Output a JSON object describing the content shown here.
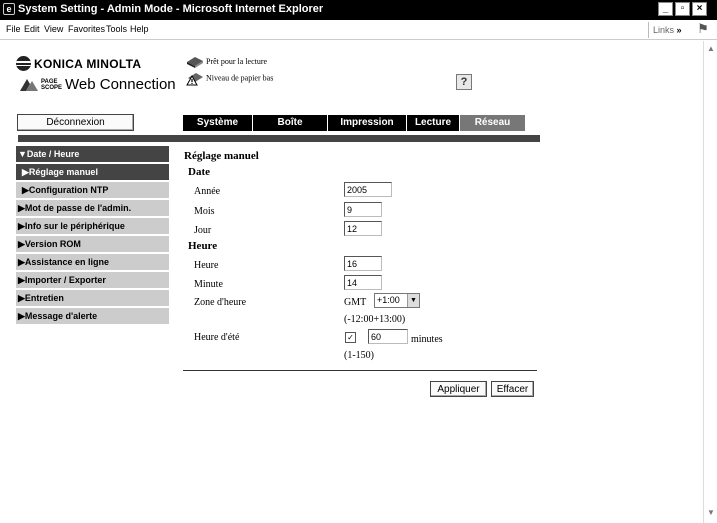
{
  "window": {
    "title": "System Setting - Admin Mode - Microsoft Internet Explorer",
    "app_icon": "ie-icon",
    "controls": [
      "minimize",
      "maximize",
      "close"
    ]
  },
  "menu": {
    "items": [
      "File",
      "Edit",
      "View",
      "Favorites",
      "Tools",
      "Help"
    ],
    "links_label": "Links",
    "links_chevron": "»"
  },
  "header": {
    "brand": "KONICA MINOLTA",
    "pagescope_line1": "PAGE",
    "pagescope_line2": "SCOPE",
    "product": "Web Connection",
    "status_ready": "Prêt pour la lecture",
    "status_paper": "Niveau de papier bas",
    "help_label": "?",
    "logout_label": "Déconnexion"
  },
  "tabs": [
    {
      "label": "Système",
      "active": false
    },
    {
      "label": "Boîte",
      "active": false
    },
    {
      "label": "Impression",
      "active": false
    },
    {
      "label": "Lecture",
      "active": false
    },
    {
      "label": "Réseau",
      "active": true
    }
  ],
  "sidebar": {
    "items": [
      {
        "label": "▼Date / Heure"
      },
      {
        "label": "▶Réglage manuel"
      },
      {
        "label": "▶Configuration NTP"
      },
      {
        "label": "▶Mot de passe de l'admin."
      },
      {
        "label": "▶Info sur le périphérique"
      },
      {
        "label": "▶Version ROM"
      },
      {
        "label": "▶Assistance en ligne"
      },
      {
        "label": "▶Importer / Exporter"
      },
      {
        "label": "▶Entretien"
      },
      {
        "label": "▶Message d'alerte"
      }
    ]
  },
  "form": {
    "title": "Réglage manuel",
    "date_section": "Date",
    "year_label": "Année",
    "year_value": "2005",
    "month_label": "Mois",
    "month_value": "9",
    "day_label": "Jour",
    "day_value": "12",
    "time_section": "Heure",
    "hour_label": "Heure",
    "hour_value": "16",
    "minute_label": "Minute",
    "minute_value": "14",
    "timezone_label": "Zone d'heure",
    "timezone_prefix": "GMT",
    "timezone_value": "+1:00",
    "timezone_range": "(-12:00+13:00)",
    "dst_label": "Heure d'été",
    "dst_checked": true,
    "dst_minutes_value": "60",
    "dst_unit": "minutes",
    "dst_range": "(1-150)",
    "apply_label": "Appliquer",
    "clear_label": "Effacer"
  },
  "colors": {
    "titlebar": "#000000",
    "tab_bar": "#000000",
    "tab_active": "#777777",
    "sidebar_item": "#cccccc",
    "sidebar_selected": "#444444"
  }
}
